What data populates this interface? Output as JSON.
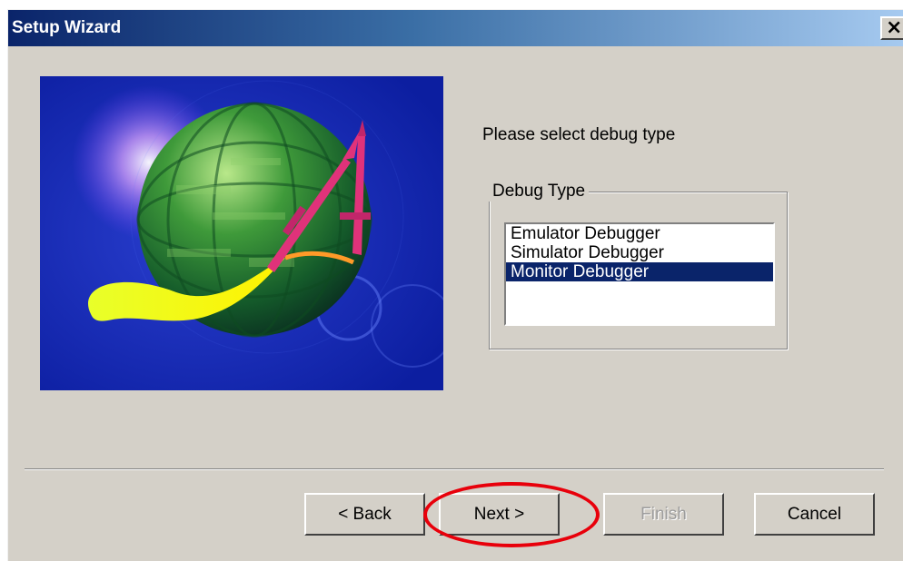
{
  "window": {
    "title": "Setup Wizard",
    "close_glyph": "×"
  },
  "content": {
    "prompt": "Please select debug type"
  },
  "debug_type": {
    "group_label": "Debug Type",
    "items": [
      {
        "label": "Emulator Debugger",
        "selected": false
      },
      {
        "label": "Simulator Debugger",
        "selected": false
      },
      {
        "label": "Monitor Debugger",
        "selected": true
      }
    ]
  },
  "buttons": {
    "back": "< Back",
    "next": "Next >",
    "finish": "Finish",
    "cancel": "Cancel"
  },
  "colors": {
    "title_bar_start": "#0a246a",
    "selection": "#0a246a",
    "highlight_annotation": "#e8000b"
  }
}
